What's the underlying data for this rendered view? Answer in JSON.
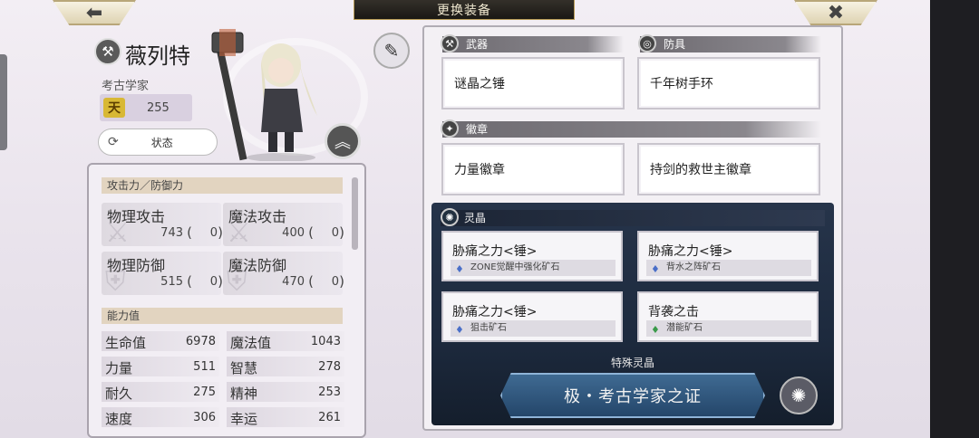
{
  "header": {
    "title": "更换装备",
    "back_icon": "arrow-left-icon",
    "close_icon": "close-icon"
  },
  "character": {
    "name": "薇列特",
    "class": "考古学家",
    "level_badge": "天",
    "level": "255",
    "status_label": "状态"
  },
  "stats": {
    "atk_def_header": "攻击力／防御力",
    "atk_def": [
      {
        "label": "物理攻击",
        "value": "743",
        "bonus": "0"
      },
      {
        "label": "魔法攻击",
        "value": "400",
        "bonus": "0"
      },
      {
        "label": "物理防御",
        "value": "515",
        "bonus": "0"
      },
      {
        "label": "魔法防御",
        "value": "470",
        "bonus": "0"
      }
    ],
    "ability_header": "能力值",
    "abilities": [
      {
        "label": "生命值",
        "value": "6978"
      },
      {
        "label": "魔法值",
        "value": "1043"
      },
      {
        "label": "力量",
        "value": "511"
      },
      {
        "label": "智慧",
        "value": "278"
      },
      {
        "label": "耐久",
        "value": "275"
      },
      {
        "label": "精神",
        "value": "253"
      },
      {
        "label": "速度",
        "value": "306"
      },
      {
        "label": "幸运",
        "value": "261"
      }
    ]
  },
  "equipment": {
    "weapon_label": "武器",
    "armor_label": "防具",
    "badge_label": "徽章",
    "weapon": "谜晶之锤",
    "armor": "千年树手环",
    "badges": [
      "力量徽章",
      "持剑的救世主徽章"
    ]
  },
  "crystals": {
    "label": "灵晶",
    "slots": [
      {
        "name": "胁痛之力<锤>",
        "ore": "ZONE觉醒中强化矿石",
        "ore_color": "#4a6fc8"
      },
      {
        "name": "胁痛之力<锤>",
        "ore": "背水之阵矿石",
        "ore_color": "#4a6fc8"
      },
      {
        "name": "胁痛之力<锤>",
        "ore": "狙击矿石",
        "ore_color": "#4a6fc8"
      },
      {
        "name": "背袭之击",
        "ore": "潜能矿石",
        "ore_color": "#3a9a4a"
      }
    ],
    "special_label": "特殊灵晶",
    "special_name": "极・考古学家之证"
  }
}
